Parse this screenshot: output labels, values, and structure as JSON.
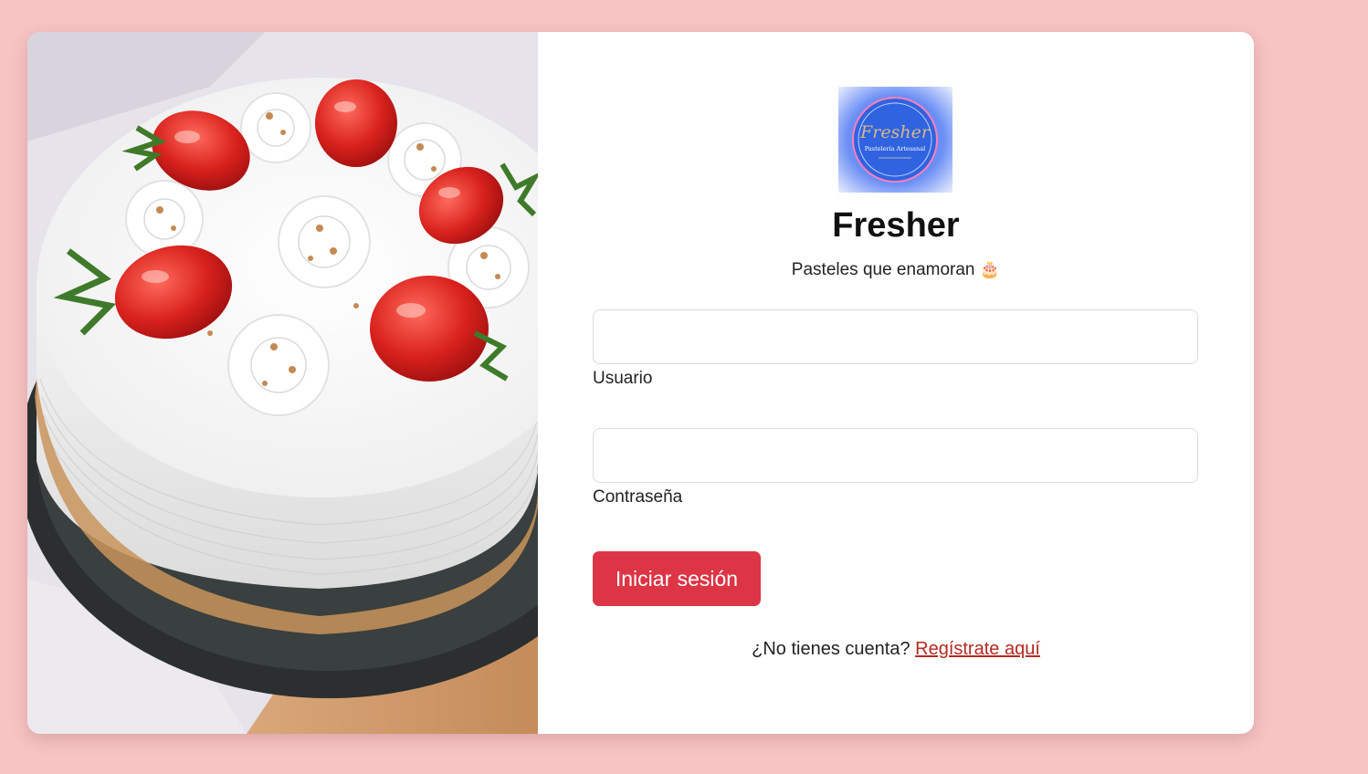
{
  "brand": {
    "name": "Fresher",
    "tagline": "Pasteles que enamoran",
    "tagline_emoji": "🎂",
    "logo_script": "Fresher",
    "logo_subtitle": "Pastelería Artesanal"
  },
  "login_form": {
    "username_label": "Usuario",
    "username_value": "",
    "password_label": "Contraseña",
    "password_value": "",
    "submit_label": "Iniciar sesión"
  },
  "register": {
    "prompt": "¿No tienes cuenta?",
    "link_label": "Regístrate aquí"
  },
  "colors": {
    "background": "#f7c3c3",
    "card": "#ffffff",
    "primary_button": "#dc3545",
    "link": "#b32a20"
  }
}
